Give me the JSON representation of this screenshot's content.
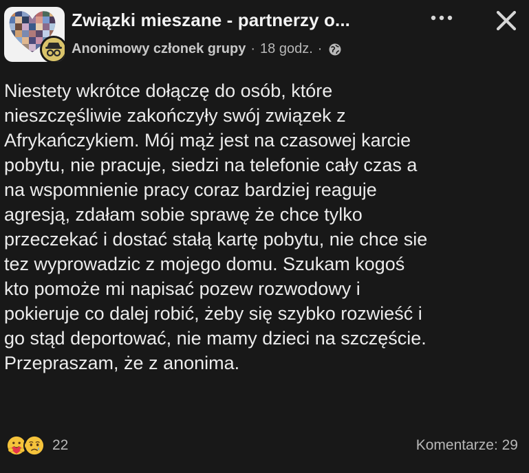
{
  "post": {
    "group_name": "Związki mieszane - partnerzy o...",
    "author": "Anonimowy członek grupy",
    "separator": "·",
    "time": "18 godz.",
    "separator2": "·",
    "more_icon": "more-dots-icon",
    "close_icon": "close-icon",
    "privacy_icon": "globe-icon",
    "body_lines": [
      "Niestety wkrótce dołączę do osób, które",
      "nieszczęśliwie zakończyły swój związek z",
      "Afrykańczykiem. Mój mąż jest na czasowej karcie",
      "pobytu, nie pracuje, siedzi na telefonie cały czas a",
      "na wspomnienie pracy coraz bardziej reaguje",
      "agresją, zdałam sobie sprawę że chce tylko",
      "przeczekać i dostać stałą kartę pobytu, nie chce sie",
      "tez wyprowadzic z mojego domu. Szukam kogoś",
      "kto pomoże mi napisać pozew rozwodowy i",
      "pokieruje co dalej robić, żeby się szybko rozwieść i",
      "go stąd deportować, nie mamy dzieci na szczęście.",
      "Przepraszam, że z anonima."
    ]
  },
  "footer": {
    "reaction_icons": [
      "care-reaction-icon",
      "sad-reaction-icon"
    ],
    "reaction_count": "22",
    "comments_label": "Komentarze: 29"
  }
}
